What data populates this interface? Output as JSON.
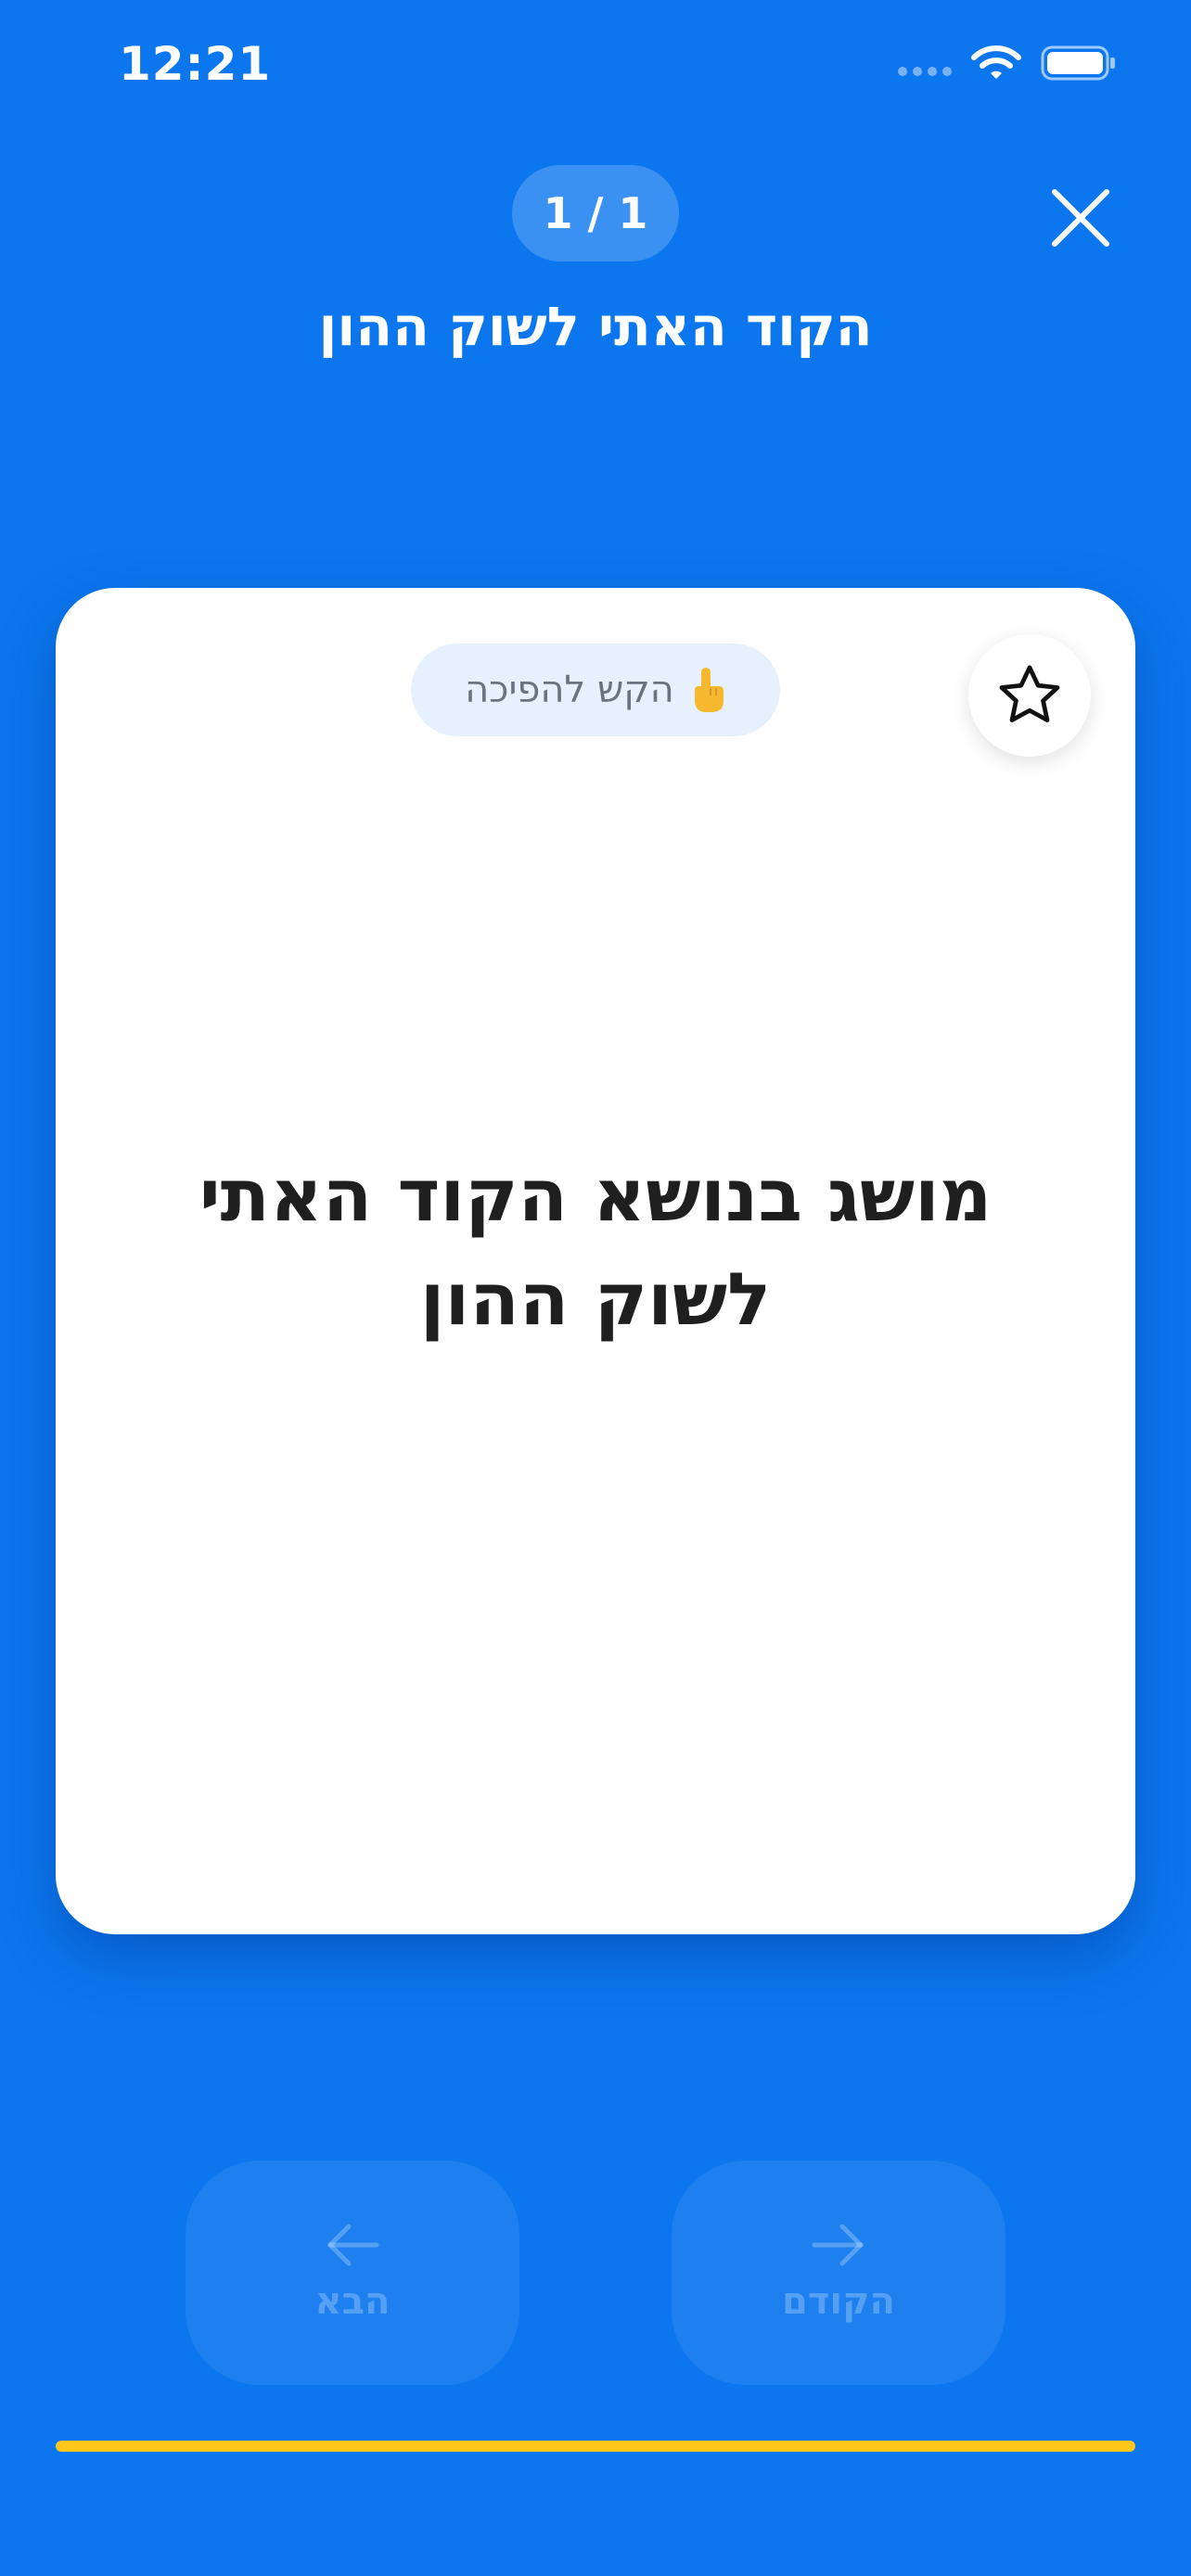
{
  "status_bar": {
    "time": "12:21",
    "signal_icon": "signal-dots-icon",
    "wifi_icon": "wifi-icon",
    "battery_icon": "battery-icon"
  },
  "header": {
    "counter": "1 / 1",
    "title": "הקוד האתי לשוק ההון",
    "close_icon": "close-icon"
  },
  "card": {
    "flip_hint": "הקש להפיכה",
    "flip_hint_icon": "pointing-hand-icon",
    "favorite_icon": "star-outline-icon",
    "term_line1": "מושג בנושא הקוד האתי",
    "term_line2": "לשוק ההון"
  },
  "navigation": {
    "next_label": "הבא",
    "next_icon": "arrow-left-icon",
    "prev_label": "הקודם",
    "prev_icon": "arrow-right-icon"
  },
  "progress": {
    "fraction": 1.0,
    "color": "#FFC61A"
  },
  "theme": {
    "background": "#0B76EE",
    "card_background": "#FFFFFF",
    "text_dark": "#1F1F1F"
  }
}
